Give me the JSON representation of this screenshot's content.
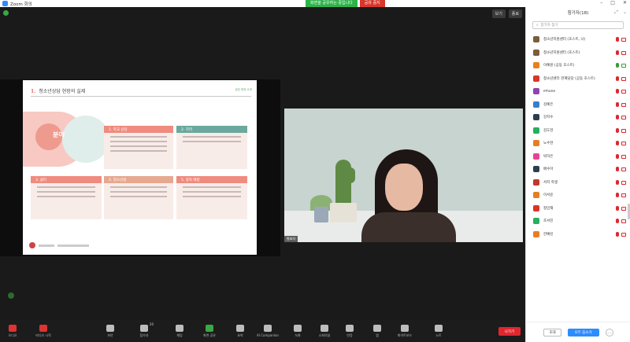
{
  "window": {
    "title": "Zoom 회의",
    "share_status": "화면을 공유하는 중입니다",
    "stop_share": "공유 중지",
    "controls": [
      "–",
      "□",
      "✕"
    ]
  },
  "main": {
    "view_button": "보기",
    "fullscreen_button": "종료"
  },
  "slide": {
    "number": "1.",
    "title": "청소년상담 현장의 실제",
    "note": "상담 현장 소개",
    "field_label": "분야",
    "cards": [
      {
        "head": "1. 학교 상담",
        "color": "#ef8b7f"
      },
      {
        "head": "2. 지역",
        "color": "#6ba89e"
      },
      {
        "head": "3. 쉼터",
        "color": "#ef8b7f"
      },
      {
        "head": "4. 청소년법",
        "color": "#e6a88f"
      },
      {
        "head": "5. 중독 예방",
        "color": "#ef8b7f"
      }
    ]
  },
  "speaker": {
    "name_tag": "발표자"
  },
  "toolbar": {
    "items": [
      {
        "label": "오디오",
        "icon": "mic-icon",
        "variant": "red"
      },
      {
        "label": "비디오 시작",
        "icon": "video-icon",
        "variant": "red"
      },
      {
        "label": "보안",
        "icon": "shield-icon",
        "variant": "normal"
      },
      {
        "label": "참가자",
        "icon": "participants-icon",
        "variant": "normal",
        "count": "20"
      },
      {
        "label": "채팅",
        "icon": "chat-icon",
        "variant": "normal"
      },
      {
        "label": "화면 공유",
        "icon": "share-screen-icon",
        "variant": "green"
      },
      {
        "label": "요약",
        "icon": "summary-icon",
        "variant": "normal"
      },
      {
        "label": "AI Companion",
        "icon": "ai-companion-icon",
        "variant": "normal"
      },
      {
        "label": "녹화",
        "icon": "record-icon",
        "variant": "normal"
      },
      {
        "label": "소회의실",
        "icon": "breakout-icon",
        "variant": "normal"
      },
      {
        "label": "반응",
        "icon": "reaction-icon",
        "variant": "normal"
      },
      {
        "label": "앱",
        "icon": "apps-icon",
        "variant": "normal"
      },
      {
        "label": "화이트보드",
        "icon": "whiteboard-icon",
        "variant": "normal"
      },
      {
        "label": "노트",
        "icon": "notes-icon",
        "variant": "normal"
      }
    ],
    "end_label": "나가기"
  },
  "panel": {
    "title": "참가자(18)",
    "search_placeholder": "참가자 찾기",
    "participants": [
      {
        "name": "청소년지원센터 (호스트, 나)",
        "color": "#7a5c3e",
        "mic": "red",
        "cam": "red"
      },
      {
        "name": "청소년지원센터 (호스트)",
        "color": "#7a5c3e",
        "mic": "red",
        "cam": "red"
      },
      {
        "name": "이예원 (공동 호스트)",
        "color": "#e8801c",
        "mic": "active",
        "cam": "active"
      },
      {
        "name": "청소년센터 관계담당 (공동 호스트)",
        "color": "#d9362b",
        "mic": "red",
        "cam": "red"
      },
      {
        "name": "iPhone",
        "color": "#8e44ad",
        "mic": "red",
        "cam": "red"
      },
      {
        "name": "김예은",
        "color": "#3a7ec9",
        "mic": "red",
        "cam": "red"
      },
      {
        "name": "강지수",
        "color": "#2c3e50",
        "mic": "red",
        "cam": "red"
      },
      {
        "name": "김도현",
        "color": "#27ae60",
        "mic": "red",
        "cam": "red"
      },
      {
        "name": "노수현",
        "color": "#e67e22",
        "mic": "red",
        "cam": "red"
      },
      {
        "name": "박하은",
        "color": "#e84393",
        "mic": "red",
        "cam": "red"
      },
      {
        "name": "배수아",
        "color": "#2c3e50",
        "mic": "red",
        "cam": "red"
      },
      {
        "name": "서지 학생",
        "color": "#c0392b",
        "mic": "red",
        "cam": "red"
      },
      {
        "name": "이서윤",
        "color": "#e67e22",
        "mic": "red",
        "cam": "red"
      },
      {
        "name": "정민재",
        "color": "#d9362b",
        "mic": "red",
        "cam": "red"
      },
      {
        "name": "조서진",
        "color": "#27ae60",
        "mic": "red",
        "cam": "red"
      },
      {
        "name": "한예린",
        "color": "#e67e22",
        "mic": "red",
        "cam": "red"
      }
    ],
    "invite_button": "초대",
    "mute_all_button": "모두 음소거",
    "more_button": "…"
  }
}
